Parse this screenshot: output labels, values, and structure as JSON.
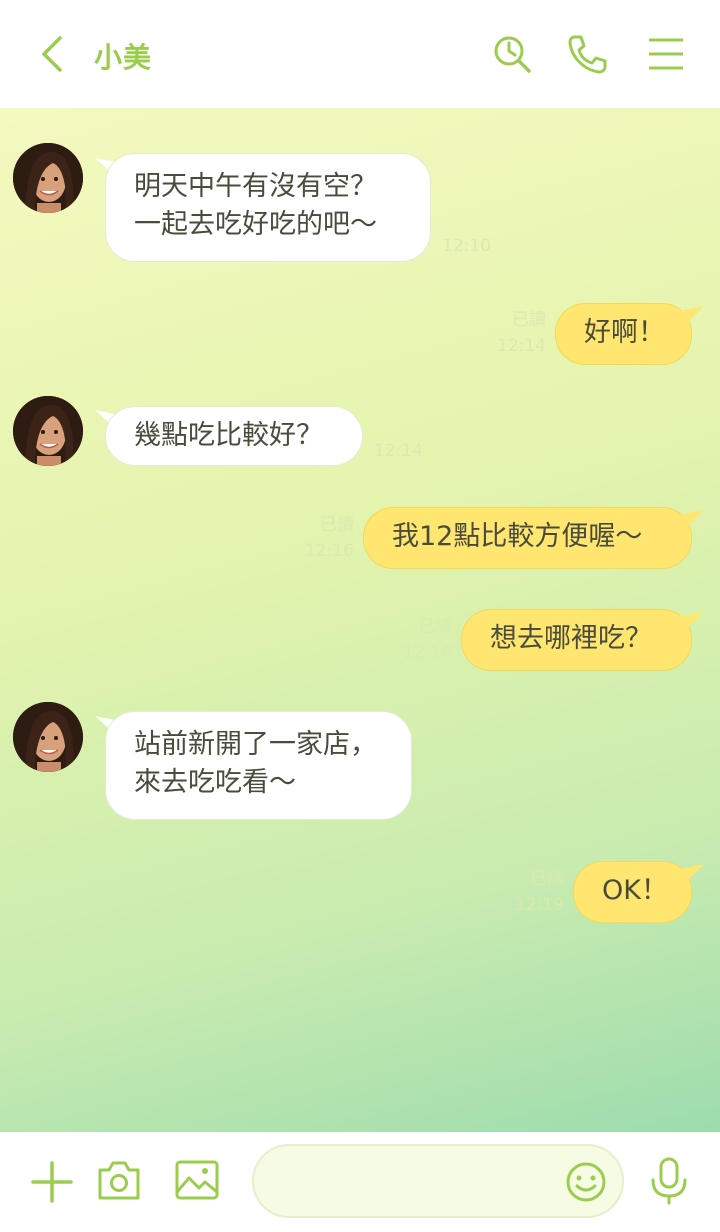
{
  "header": {
    "contact_name": "小美",
    "icons": [
      "back-chevron-icon",
      "search-clock-icon",
      "phone-icon",
      "menu-icon"
    ]
  },
  "messages": [
    {
      "side": "in",
      "lines": [
        "明天中午有沒有空？",
        "一起去吃好吃的吧～"
      ],
      "time": "12:10"
    },
    {
      "side": "out",
      "lines": [
        "好啊！"
      ],
      "read": "已讀",
      "time": "12:14"
    },
    {
      "side": "in",
      "lines": [
        "幾點吃比較好？"
      ],
      "time": "12:14"
    },
    {
      "side": "out",
      "lines": [
        "我12點比較方便喔～"
      ],
      "read": "已讀",
      "time": "12:16"
    },
    {
      "side": "out",
      "lines": [
        "想去哪裡吃？"
      ],
      "read": "已讀",
      "time": "12:16"
    },
    {
      "side": "in",
      "lines": [
        "站前新開了一家店，",
        "來去吃吃看～"
      ],
      "time": "12:19"
    },
    {
      "side": "out",
      "lines": [
        "OK！"
      ],
      "read": "已讀",
      "time": "12:19"
    }
  ],
  "footer": {
    "input_value": "",
    "icons": [
      "plus-icon",
      "camera-icon",
      "image-icon",
      "emoji-icon",
      "microphone-icon"
    ]
  },
  "colors": {
    "accent": "#9ccc4e",
    "outgoing_bubble": "#ffe670",
    "incoming_bubble": "#ffffff",
    "text": "#4b4b3c",
    "meta_text": "#d8eab0"
  }
}
